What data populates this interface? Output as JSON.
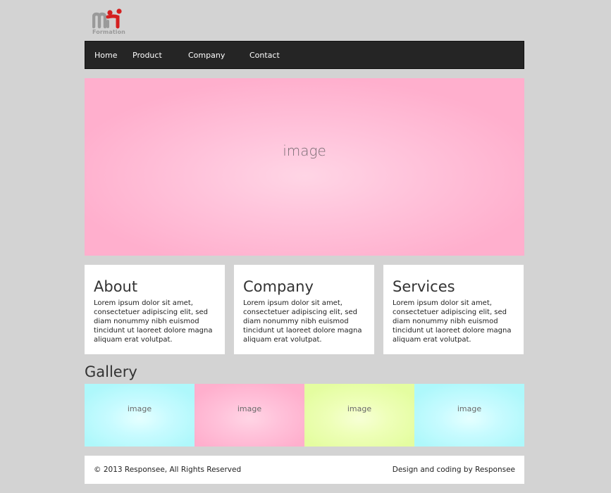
{
  "logo": {
    "text": "Formation",
    "icon": "mi-logo-icon",
    "colors": {
      "gray": "#9a9a9a",
      "red": "#d42020"
    }
  },
  "nav": {
    "items": [
      "Home",
      "Product",
      "Company",
      "Contact"
    ]
  },
  "hero": {
    "label": "image"
  },
  "cards": [
    {
      "title": "About",
      "text": "Lorem ipsum dolor sit amet, consectetuer adipiscing elit, sed diam nonummy nibh euismod tincidunt ut laoreet dolore magna aliquam erat volutpat."
    },
    {
      "title": "Company",
      "text": "Lorem ipsum dolor sit amet, consectetuer adipiscing elit, sed diam nonummy nibh euismod tincidunt ut laoreet dolore magna aliquam erat volutpat."
    },
    {
      "title": "Services",
      "text": "Lorem ipsum dolor sit amet, consectetuer adipiscing elit, sed diam nonummy nibh euismod tincidunt ut laoreet dolore magna aliquam erat volutpat."
    }
  ],
  "gallery": {
    "title": "Gallery",
    "items": [
      "image",
      "image",
      "image",
      "image"
    ]
  },
  "footer": {
    "copyright": "© 2013 Responsee, All Rights Reserved",
    "credit": "Design and coding by Responsee"
  }
}
